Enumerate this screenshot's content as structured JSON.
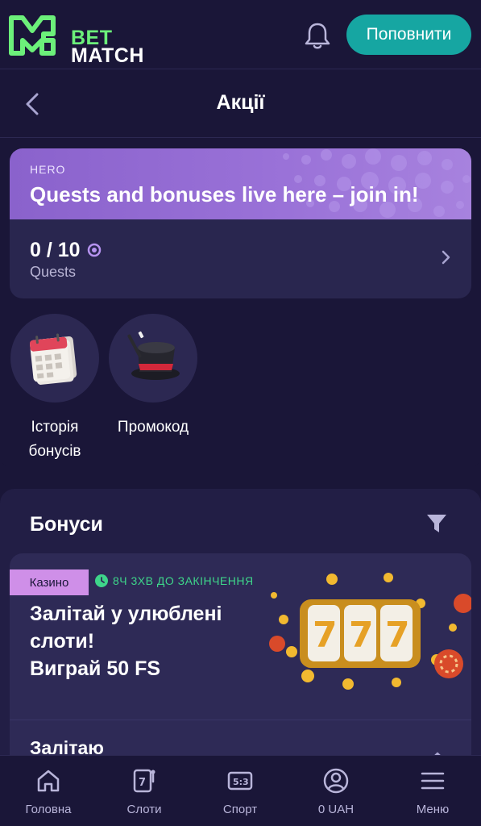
{
  "header": {
    "logo_line1": "BET",
    "logo_line2": "MATCH",
    "topup_label": "Поповнити",
    "bell_icon": "bell-icon"
  },
  "subheader": {
    "title": "Акції",
    "back_icon": "chevron-left-icon"
  },
  "hero": {
    "tag": "HERO",
    "title": "Quests and bonuses live here – join in!",
    "progress": "0 / 10",
    "quests_label": "Quests",
    "progress_fraction": 0.0
  },
  "shortcuts": [
    {
      "label_line1": "Історія",
      "label_line2": "бонусів",
      "icon": "calendar-icon"
    },
    {
      "label_line1": "Промокод",
      "label_line2": "",
      "icon": "magic-hat-icon"
    }
  ],
  "bonuses": {
    "heading": "Бонуси",
    "filter_icon": "filter-icon",
    "card": {
      "badge": "Казино",
      "timer": "8Ч 3ХВ ДО ЗАКІНЧЕННЯ",
      "title_line1": "Залітай у улюблені",
      "title_line2": "слоти!",
      "title_line3": "Виграй 50 FS",
      "cta": "Залітаю"
    }
  },
  "nav": [
    {
      "label": "Головна",
      "icon": "home-icon"
    },
    {
      "label": "Слоти",
      "icon": "slots-icon"
    },
    {
      "label": "Спорт",
      "icon": "scoreboard-icon"
    },
    {
      "label": "0 UAH",
      "icon": "user-icon"
    },
    {
      "label": "Меню",
      "icon": "menu-icon"
    }
  ],
  "colors": {
    "background": "#1a1638",
    "accent": "#16a6a2",
    "logo_green": "#6cf07a",
    "hero_purple": "#9a72d8",
    "badge_pink": "#cf8fe8",
    "timer_green": "#3ed58a"
  }
}
